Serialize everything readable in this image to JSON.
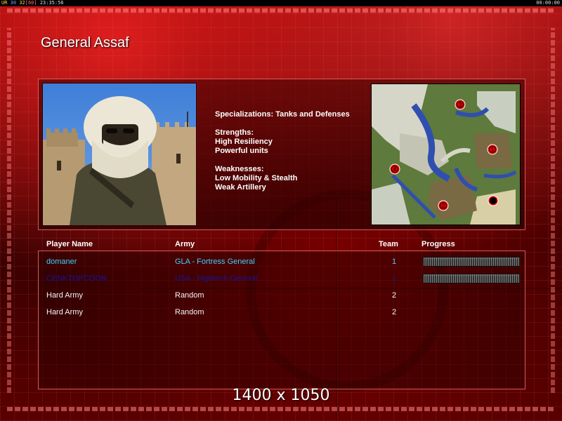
{
  "hud": {
    "left_prefix": "UR",
    "fps_current": "30",
    "fps_cap": "32",
    "fps_bracket": "[60]",
    "clock": "23:35:56",
    "timer": "00:00:00"
  },
  "general": {
    "name": "General Assaf",
    "specializations": "Specializations: Tanks and Defenses",
    "strengths_heading": "Strengths:",
    "strengths": [
      "High Resiliency",
      "Powerful units"
    ],
    "weaknesses_heading": "Weaknesses:",
    "weaknesses": [
      "Low Mobility & Stealth",
      "Weak Artillery"
    ]
  },
  "map": {
    "start_positions": [
      "1",
      "2",
      "3",
      "4",
      "5"
    ]
  },
  "table": {
    "headers": {
      "player": "Player Name",
      "army": "Army",
      "team": "Team",
      "progress": "Progress"
    },
    "rows": [
      {
        "player": "domaner",
        "army": "GLA - Fortress General",
        "team": "1",
        "progress": 1.0
      },
      {
        "player": "CENKTOPCOON",
        "army": "USA - Hightech General",
        "team": "1",
        "progress": 1.0
      },
      {
        "player": "Hard Army",
        "army": "Random",
        "team": "2"
      },
      {
        "player": "Hard Army",
        "army": "Random",
        "team": "2"
      }
    ]
  },
  "resolution": "1400 x 1050",
  "colors": {
    "accent_red": "#e00000",
    "player_cyan": "#3fd0ff",
    "player_navy": "#1414a0"
  }
}
